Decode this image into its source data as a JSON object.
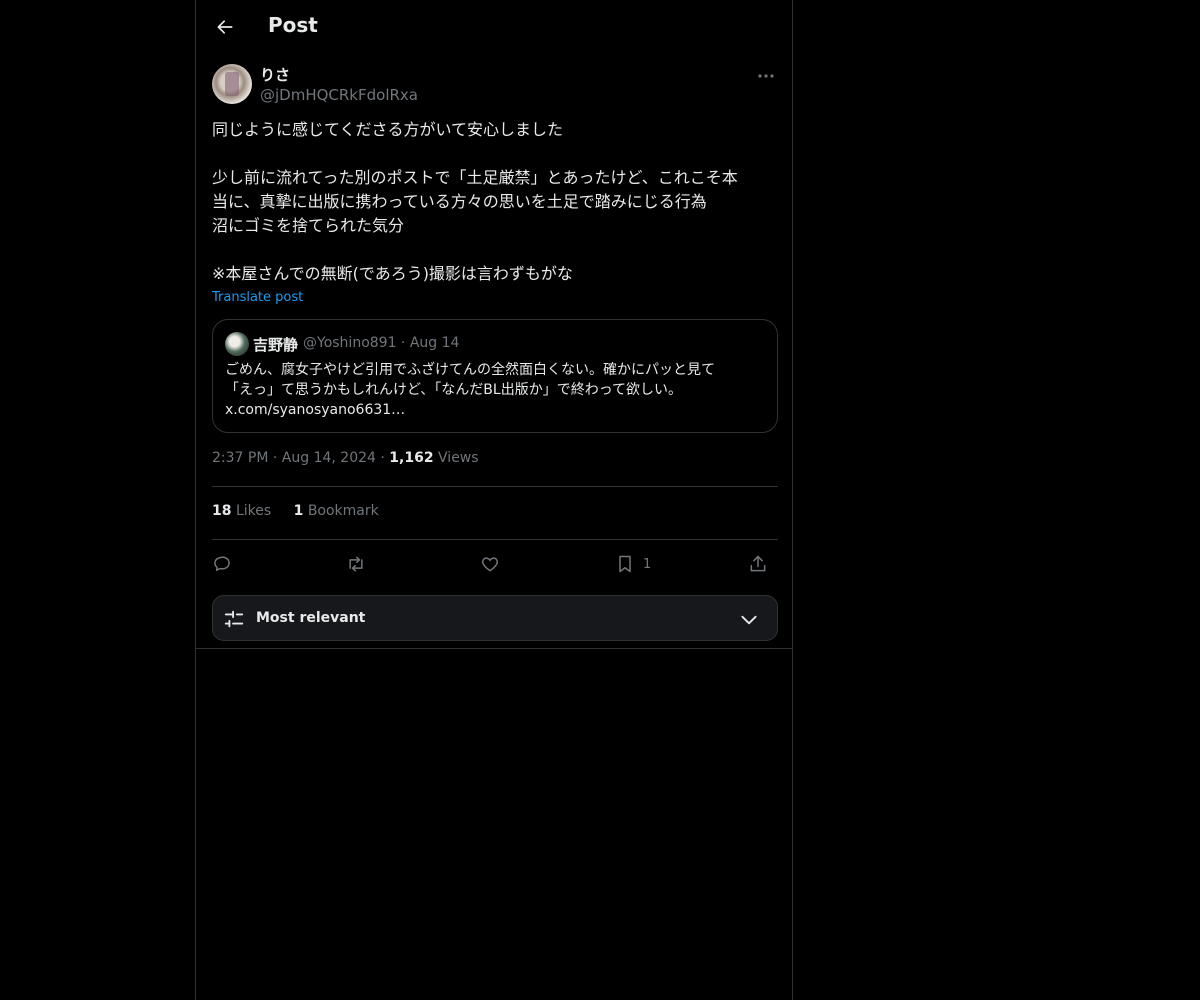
{
  "header": {
    "title": "Post"
  },
  "post": {
    "author_name": "りさ",
    "author_handle": "@jDmHQCRkFdolRxa",
    "lines": [
      "同じように感じてくださる方がいて安心しました",
      "",
      "少し前に流れてった別のポストで「土足厳禁」とあったけど、これこそ本",
      "当に、真摯に出版に携わっている方々の思いを土足で踏みにじる行為",
      "沼にゴミを捨てられた気分",
      "",
      "※本屋さんでの無断(であろう)撮影は言わずもがな"
    ],
    "translate_label": "Translate post"
  },
  "quote": {
    "name": "吉野静",
    "meta": "@Yoshino891 · Aug 14",
    "text_line1": "ごめん、腐女子やけど引用でふざけてんの全然面白くない。確かにパッと見て",
    "text_line2": "「えっ」て思うかもしれんけど、「なんだBL出版か」で終わって欲しい。",
    "text_line3": "x.com/syanosyano6631…"
  },
  "meta": {
    "time": "2:37 PM",
    "date": "Aug 14, 2024",
    "views_count": "1,162",
    "views_label": "Views",
    "sep": "·"
  },
  "stats": {
    "likes_count": "18",
    "likes_label": "Likes",
    "bookmarks_count": "1",
    "bookmarks_label": "Bookmark"
  },
  "actions": {
    "bookmark_count": "1"
  },
  "sort": {
    "label": "Most relevant"
  },
  "colors": {
    "background": "#000000",
    "accent": "#1d9bf0",
    "muted": "#71767b",
    "border": "#2f3336"
  }
}
